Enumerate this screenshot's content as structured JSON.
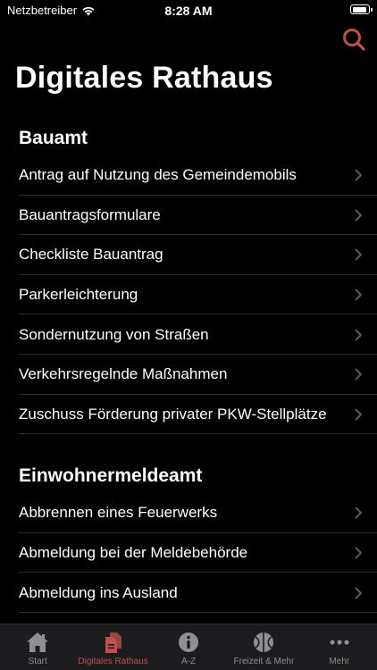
{
  "status_bar": {
    "carrier": "Netzbetreiber",
    "time": "8:28 AM",
    "battery_level": 0.95
  },
  "header": {
    "title": "Digitales Rathaus",
    "search_icon": "search-icon"
  },
  "colors": {
    "accent": "#c0504a",
    "tab_inactive": "#8e8e93",
    "tab_bar_bg": "#1c1c1e",
    "separator": "#2a2a2c"
  },
  "sections": [
    {
      "title": "Bauamt",
      "items": [
        "Antrag auf Nutzung des Gemeindemobils",
        "Bauantragsformulare",
        "Checkliste Bauantrag",
        "Parkerleichterung",
        "Sondernutzung von Straßen",
        "Verkehrsregelnde Maßnahmen",
        "Zuschuss Förderung privater PKW-Stellplätze"
      ]
    },
    {
      "title": "Einwohnermeldeamt",
      "items": [
        "Abbrennen eines Feuerwerks",
        "Abmeldung bei der Meldebehörde",
        "Abmeldung ins Ausland"
      ]
    }
  ],
  "tabs": [
    {
      "label": "Start",
      "icon": "house-icon"
    },
    {
      "label": "Digitales Rathaus",
      "icon": "documents-icon",
      "active": true
    },
    {
      "label": "A-Z",
      "icon": "info-icon"
    },
    {
      "label": "Freizeit & Mehr",
      "icon": "ball-icon"
    },
    {
      "label": "Mehr",
      "icon": "more-icon"
    }
  ]
}
